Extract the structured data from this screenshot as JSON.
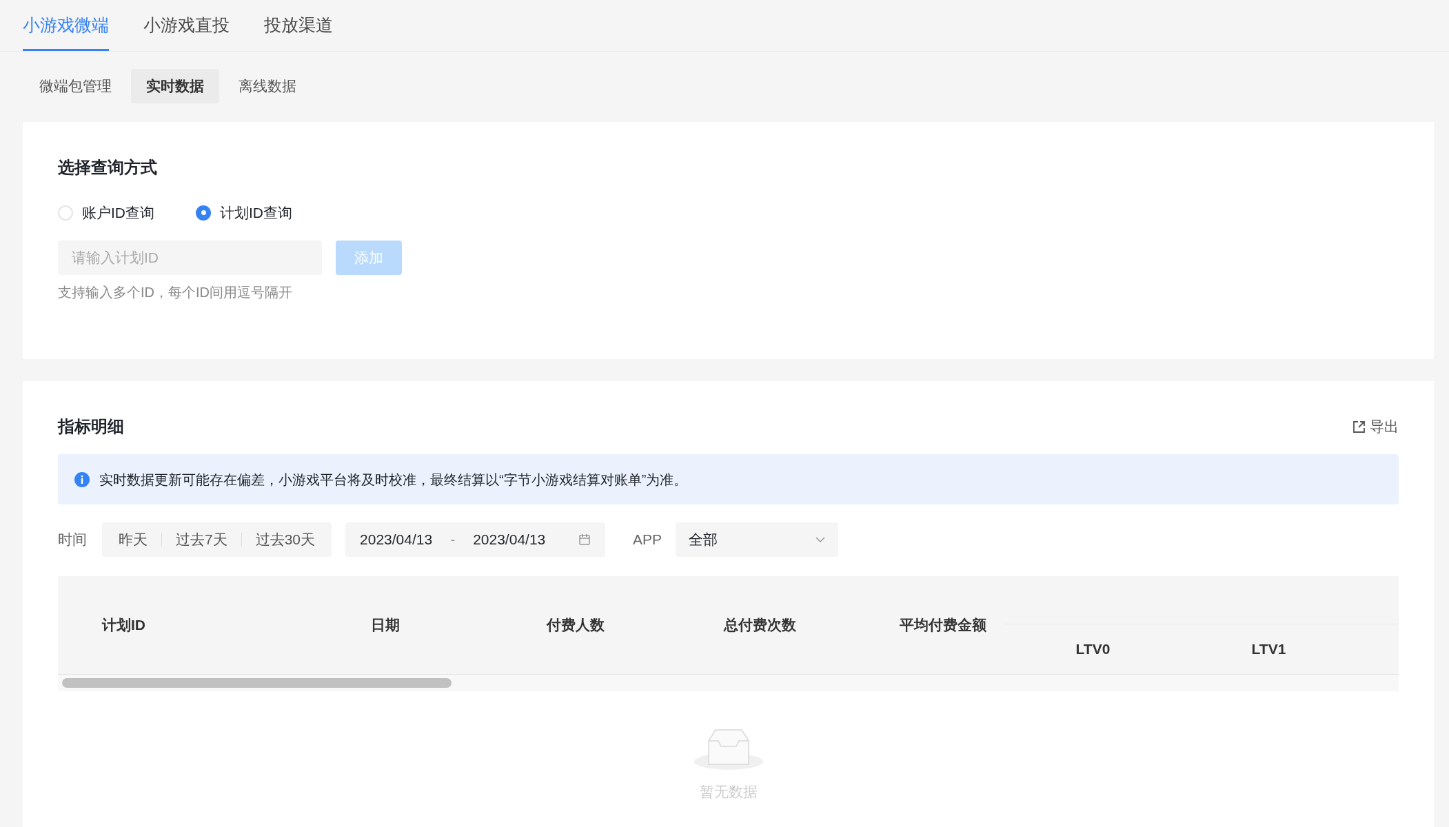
{
  "top_tabs": [
    {
      "label": "小游戏微端",
      "selected": true
    },
    {
      "label": "小游戏直投",
      "selected": false
    },
    {
      "label": "投放渠道",
      "selected": false
    }
  ],
  "sub_tabs": [
    {
      "label": "微端包管理",
      "selected": false
    },
    {
      "label": "实时数据",
      "selected": true
    },
    {
      "label": "离线数据",
      "selected": false
    }
  ],
  "query_card": {
    "title": "选择查询方式",
    "options": [
      {
        "label": "账户ID查询",
        "selected": false
      },
      {
        "label": "计划ID查询",
        "selected": true
      }
    ],
    "input": {
      "placeholder": "请输入计划ID"
    },
    "add_button": {
      "label": "添加",
      "disabled": true
    },
    "hint": "支持输入多个ID，每个ID间用逗号隔开"
  },
  "detail_card": {
    "title": "指标明细",
    "export_label": "导出",
    "notice": "实时数据更新可能存在偏差，小游戏平台将及时校准，最终结算以“字节小游戏结算对账单”为准。",
    "filters": {
      "time_label": "时间",
      "quick_ranges": [
        "昨天",
        "过去7天",
        "过去30天"
      ],
      "date_start": "2023/04/13",
      "date_separator": "-",
      "date_end": "2023/04/13",
      "app_label": "APP",
      "app_value": "全部"
    },
    "table": {
      "columns": [
        "计划ID",
        "日期",
        "付费人数",
        "总付费次数",
        "平均付费金额"
      ],
      "group_columns": [
        "LTV0",
        "LTV1"
      ]
    },
    "empty_text": "暂无数据"
  }
}
